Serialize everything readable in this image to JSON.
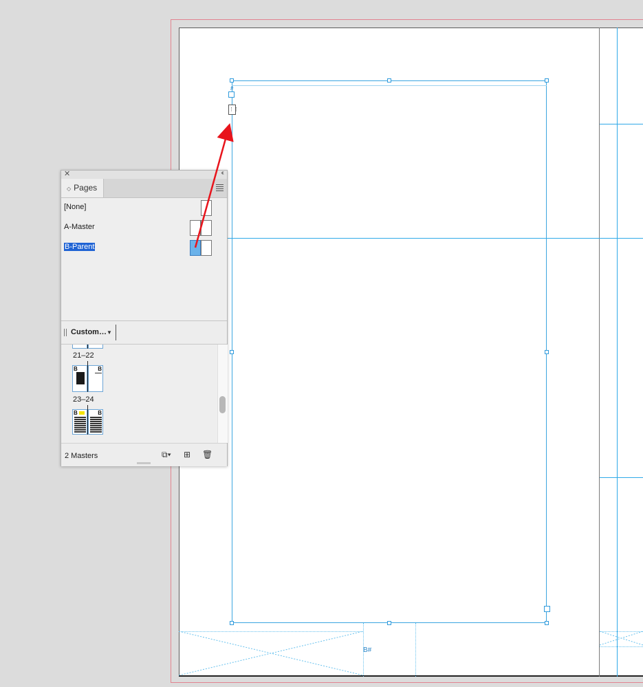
{
  "panel": {
    "tab_label": "Pages",
    "masters": [
      {
        "label": "[None]"
      },
      {
        "label": "A-Master"
      },
      {
        "label": "B-Parent",
        "selected": true
      }
    ],
    "view_menu_label": "Custom…",
    "spreads": [
      {
        "label": "21–22"
      },
      {
        "label": "23–24"
      }
    ],
    "master_letter": "B",
    "status_text": "2 Masters"
  },
  "canvas": {
    "frame_marker": "B#",
    "hash_marker": "#",
    "thread_glyph": "⋮⋮"
  },
  "colors": {
    "guide": "#2fa9e8",
    "bleed": "#e2838f",
    "selection": "#1f63d4",
    "arrow": "#e8141c"
  }
}
